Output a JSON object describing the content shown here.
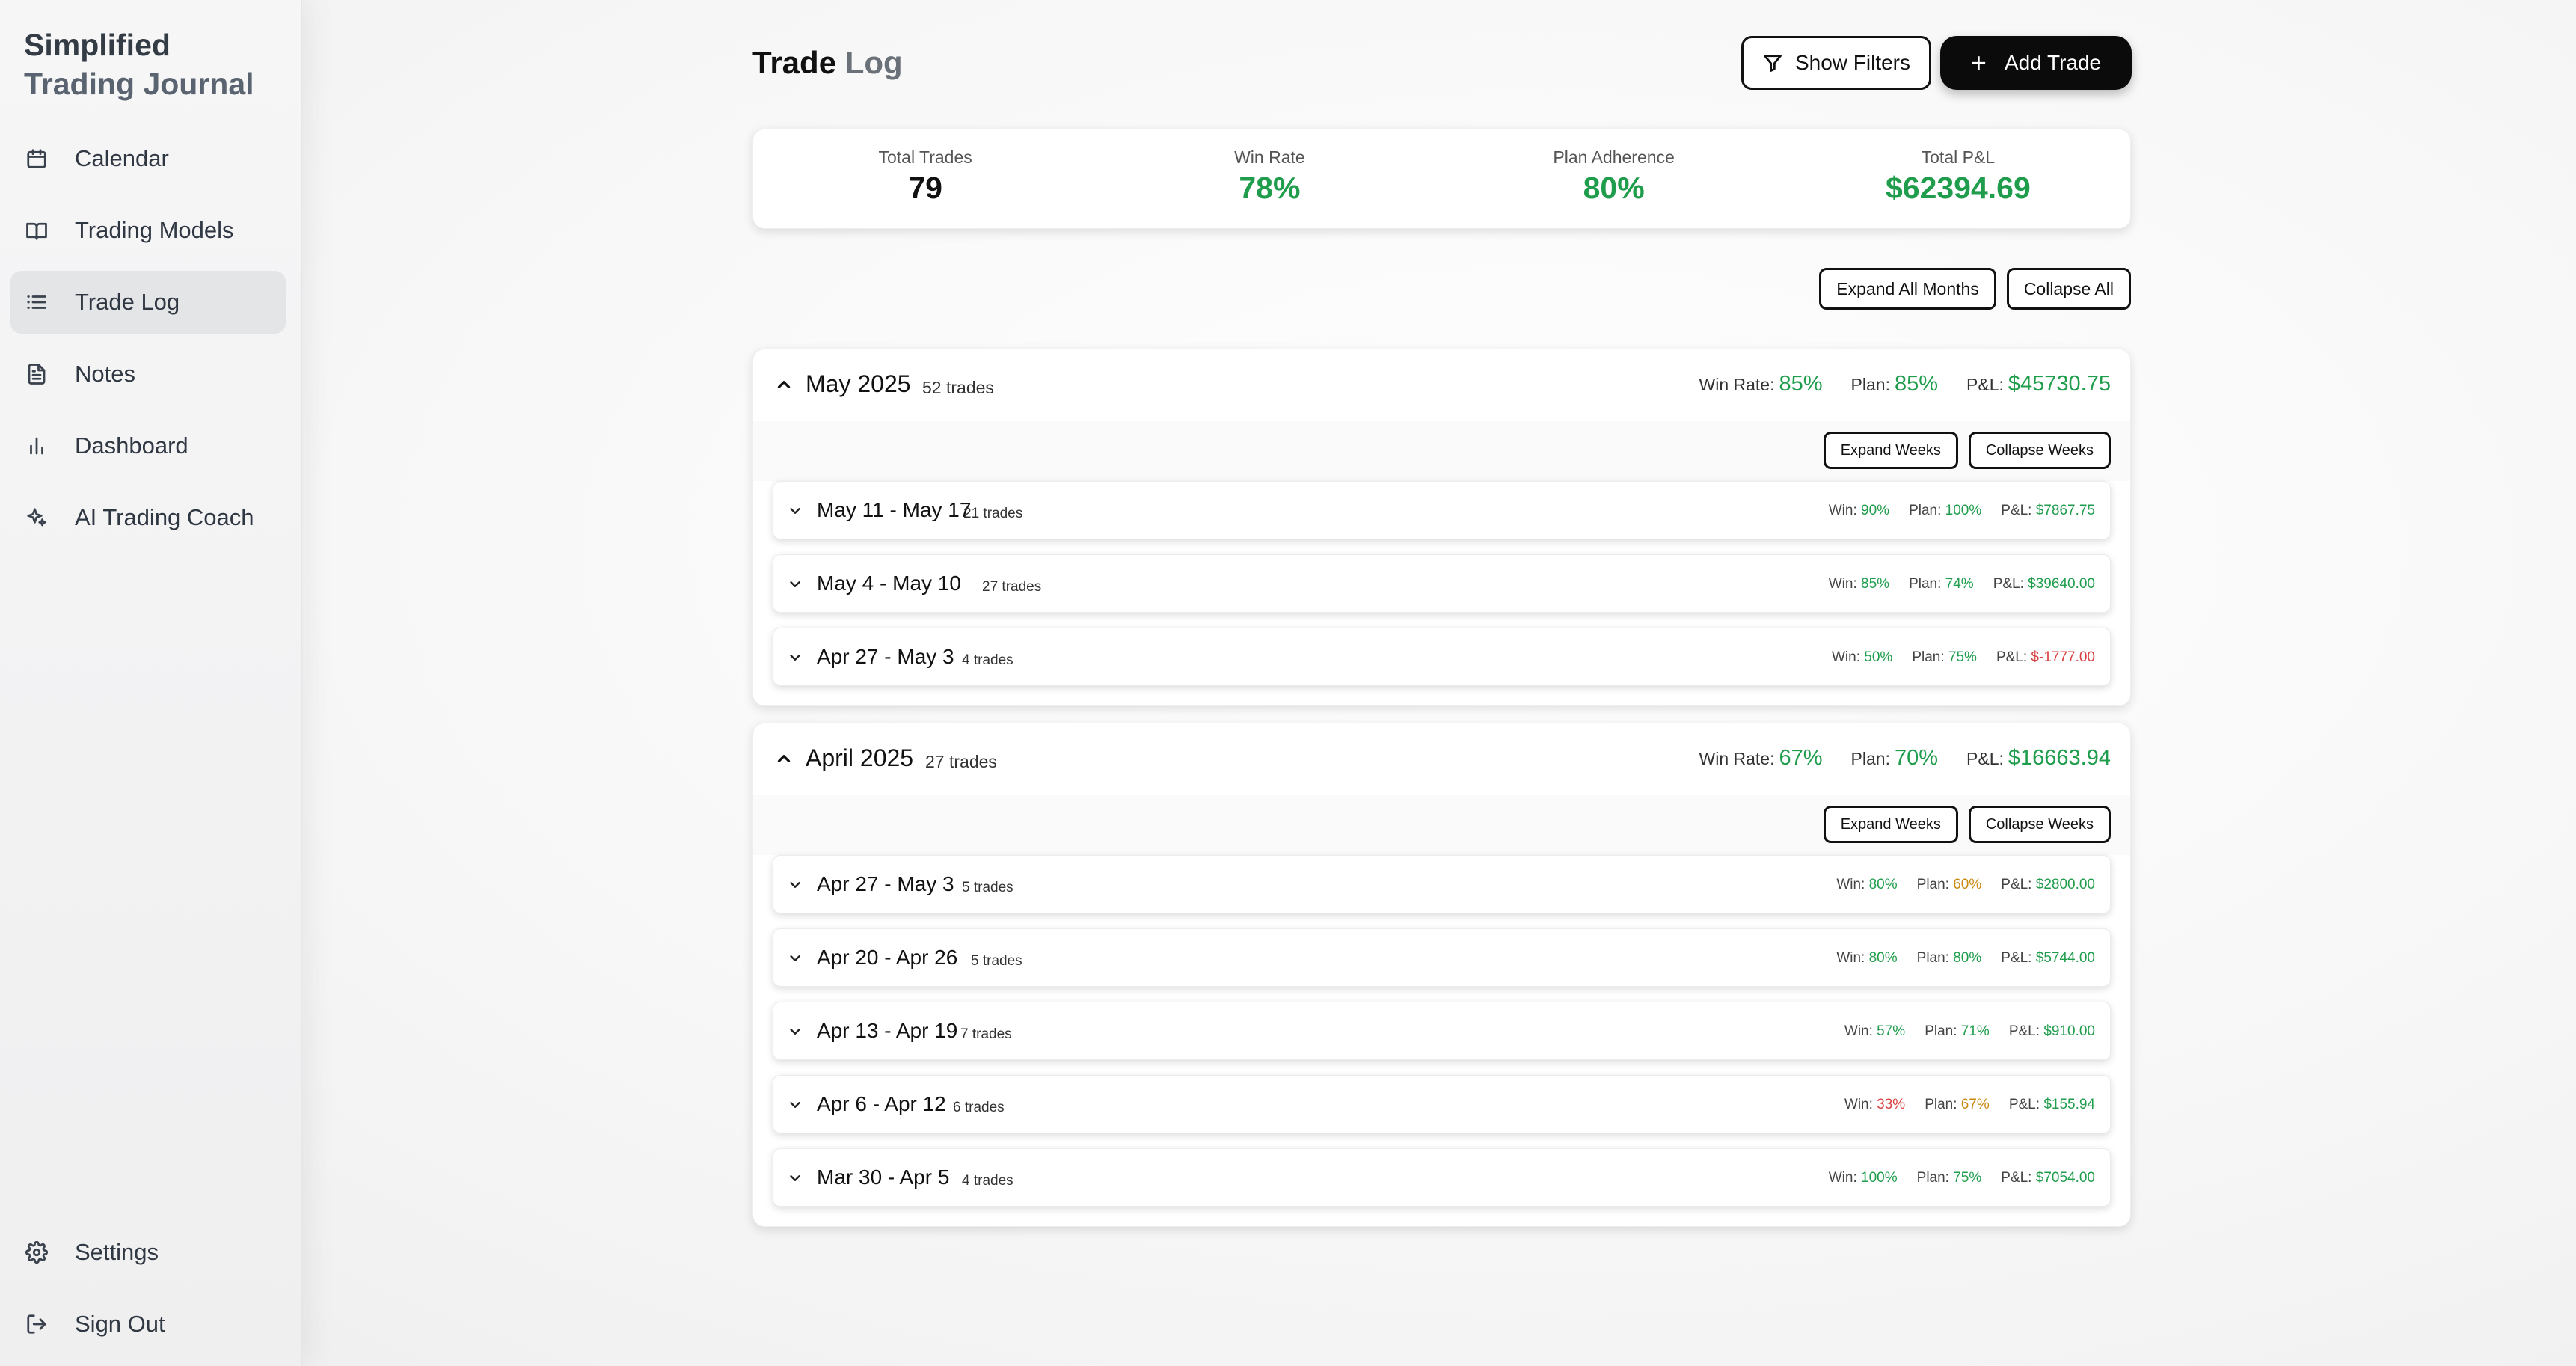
{
  "sidebar": {
    "brand_line1": "Simplified",
    "brand_line2": "Trading Journal",
    "items": [
      {
        "label": "Calendar",
        "icon": "calendar-icon"
      },
      {
        "label": "Trading Models",
        "icon": "book-icon"
      },
      {
        "label": "Trade Log",
        "icon": "list-icon",
        "active": true
      },
      {
        "label": "Notes",
        "icon": "document-icon"
      },
      {
        "label": "Dashboard",
        "icon": "bar-chart-icon"
      },
      {
        "label": "AI Trading Coach",
        "icon": "sparkles-icon"
      }
    ],
    "bottom": [
      {
        "label": "Settings",
        "icon": "gear-icon"
      },
      {
        "label": "Sign Out",
        "icon": "sign-out-icon"
      }
    ]
  },
  "header": {
    "title_part1": "Trade",
    "title_part2": "Log",
    "filters_label": "Show Filters",
    "add_label": "Add Trade"
  },
  "stats": [
    {
      "label": "Total Trades",
      "value": "79",
      "color": "#111111"
    },
    {
      "label": "Win Rate",
      "value": "78%",
      "color": "#1f9d4c"
    },
    {
      "label": "Plan Adherence",
      "value": "80%",
      "color": "#1f9d4c"
    },
    {
      "label": "Total P&L",
      "value": "$62394.69",
      "color": "#1f9d4c"
    }
  ],
  "controls": {
    "expand_all": "Expand All Months",
    "collapse_all": "Collapse All"
  },
  "month_labels": {
    "win_rate": "Win Rate:",
    "plan": "Plan:",
    "pnl": "P&L:",
    "expand_weeks": "Expand Weeks",
    "collapse_weeks": "Collapse Weeks"
  },
  "week_labels": {
    "win": "Win:",
    "plan": "Plan:",
    "pnl": "P&L:"
  },
  "months": [
    {
      "name": "May 2025",
      "count": "52 trades",
      "win_rate": "85%",
      "plan": "85%",
      "pnl": "$45730.75",
      "weeks": [
        {
          "range": "May 11 - May 17",
          "count": "21 trades",
          "win": "90%",
          "plan": "100%",
          "pnl": "$7867.75",
          "win_color": "green",
          "plan_color": "green",
          "pnl_color": "green"
        },
        {
          "range": "May 4 - May 10",
          "count": "27 trades",
          "win": "85%",
          "plan": "74%",
          "pnl": "$39640.00",
          "win_color": "green",
          "plan_color": "green",
          "pnl_color": "green"
        },
        {
          "range": "Apr 27 - May 3",
          "count": "4 trades",
          "win": "50%",
          "plan": "75%",
          "pnl": "$-1777.00",
          "win_color": "green",
          "plan_color": "green",
          "pnl_color": "red"
        }
      ]
    },
    {
      "name": "April 2025",
      "count": "27 trades",
      "win_rate": "67%",
      "plan": "70%",
      "pnl": "$16663.94",
      "weeks": [
        {
          "range": "Apr 27 - May 3",
          "count": "5 trades",
          "win": "80%",
          "plan": "60%",
          "pnl": "$2800.00",
          "win_color": "green",
          "plan_color": "amber",
          "pnl_color": "green"
        },
        {
          "range": "Apr 20 - Apr 26",
          "count": "5 trades",
          "win": "80%",
          "plan": "80%",
          "pnl": "$5744.00",
          "win_color": "green",
          "plan_color": "green",
          "pnl_color": "green"
        },
        {
          "range": "Apr 13 - Apr 19",
          "count": "7 trades",
          "win": "57%",
          "plan": "71%",
          "pnl": "$910.00",
          "win_color": "green",
          "plan_color": "green",
          "pnl_color": "green"
        },
        {
          "range": "Apr 6 - Apr 12",
          "count": "6 trades",
          "win": "33%",
          "plan": "67%",
          "pnl": "$155.94",
          "win_color": "red",
          "plan_color": "amber",
          "pnl_color": "green"
        },
        {
          "range": "Mar 30 - Apr 5",
          "count": "4 trades",
          "win": "100%",
          "plan": "75%",
          "pnl": "$7054.00",
          "win_color": "green",
          "plan_color": "green",
          "pnl_color": "green"
        }
      ]
    }
  ]
}
